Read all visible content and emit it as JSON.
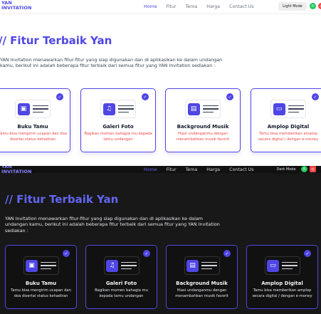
{
  "app": {
    "logo_line1": "YAN",
    "logo_line2": "INVITATION"
  },
  "nav": {
    "links": [
      "Home",
      "Fitur",
      "Tema",
      "Harga",
      "Contact Us"
    ]
  },
  "light": {
    "mode_button": "Light Mode",
    "whatsapp_icon": "whatsapp-icon",
    "instagram_icon": "instagram-icon"
  },
  "dark": {
    "mode_button": "Dark Mode"
  },
  "section": {
    "title": "// Fitur Terbaik Yan",
    "description": "YAN Invitation menawarkan fitur-fitur yang siap digunakan dan di aplikasikan ke dalam undangan kamu, berikut ini adalah beberapa fitur terbaik dari semua fitur yang YAN Invitation sediakan :"
  },
  "features": [
    {
      "title": "Buku Tamu",
      "desc": "Tamu bisa mengirim ucapan dan doa disertai status kehadiran",
      "icon": "guestbook-icon"
    },
    {
      "title": "Galeri Foto",
      "desc": "Bagikan momen bahagia mu kepada tamu undangan",
      "icon": "music-gallery-icon"
    },
    {
      "title": "Background Musik",
      "desc": "Hiasi undanganmu dengan menambahkan musik favorit",
      "icon": "image-music-icon"
    },
    {
      "title": "Amplop Digital",
      "desc": "Tamu bisa memberikan amplop secara digital / dengan e-money",
      "icon": "id-card-icon"
    }
  ],
  "colors": {
    "accent": "#4f46e5",
    "dark_bg": "#181818",
    "light_bg": "#ffffff"
  }
}
